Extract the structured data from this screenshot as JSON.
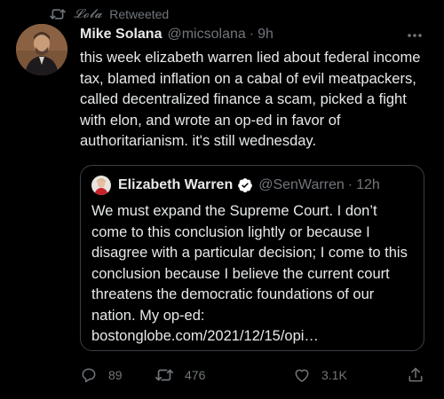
{
  "retweet_header": {
    "icon": "retweet-icon",
    "name": "𝓛𝓸𝓵𝓪",
    "label": "Retweeted"
  },
  "tweet": {
    "author_name": "Mike Solana",
    "author_handle": "@micsolana",
    "separator": "·",
    "time": "9h",
    "text": "this week elizabeth warren lied about federal income tax, blamed inflation on a cabal of evil meatpackers, called decentralized finance a scam, picked a fight with elon, and wrote an op-ed in favor of authoritarianism. it's still wednesday.",
    "more_icon": "more-horizontal-icon"
  },
  "quoted_tweet": {
    "author_name": "Elizabeth Warren",
    "verified_icon": "verified-badge-icon",
    "author_handle": "@SenWarren",
    "separator": "·",
    "time": "12h",
    "text": "We must expand the Supreme Court. I don’t come to this conclusion lightly or because I disagree with a particular decision; I come to this conclusion because I believe the current court threatens the democratic foundations of our nation. My op-ed:",
    "link": "bostonglobe.com/2021/12/15/opi…"
  },
  "actions": {
    "reply_count": "89",
    "retweet_count": "476",
    "like_count": "3.1K"
  },
  "colors": {
    "background": "#000000",
    "text_primary": "#e7e9ea",
    "text_secondary": "#71767b",
    "card_border": "#3a3f44",
    "verified_blue": "#ffffff"
  }
}
